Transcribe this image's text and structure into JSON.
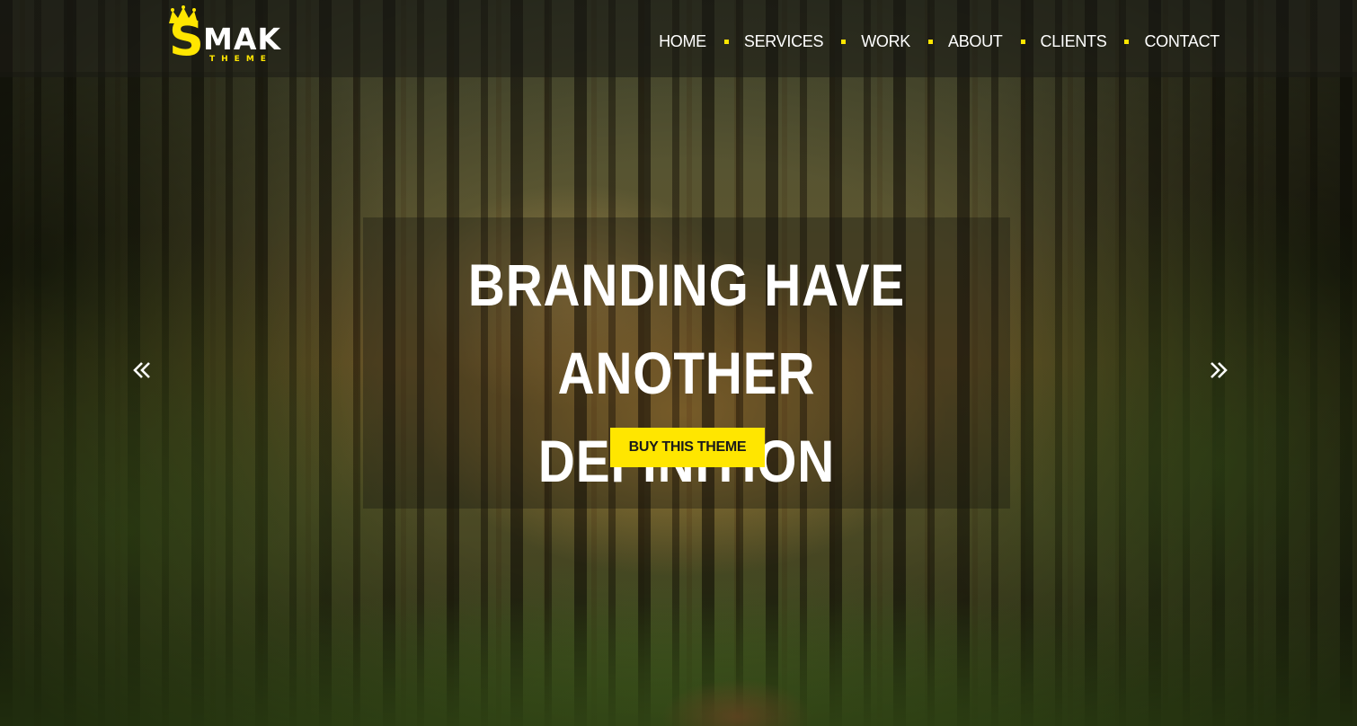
{
  "brand": {
    "logo_letter": "S",
    "logo_word": "MAK",
    "logo_sub": "THEME",
    "accent_color": "#ffe600"
  },
  "nav": {
    "items": [
      {
        "label": "HOME"
      },
      {
        "label": "SERVICES"
      },
      {
        "label": "WORK"
      },
      {
        "label": "ABOUT"
      },
      {
        "label": "CLIENTS"
      },
      {
        "label": "CONTACT"
      }
    ]
  },
  "hero": {
    "headline_line1": "BRANDING HAVE ANOTHER",
    "headline_line2": "DEFINITION",
    "cta_label": "BUY THIS THEME",
    "prev_icon": "double-chevron-left-icon",
    "next_icon": "double-chevron-right-icon"
  }
}
